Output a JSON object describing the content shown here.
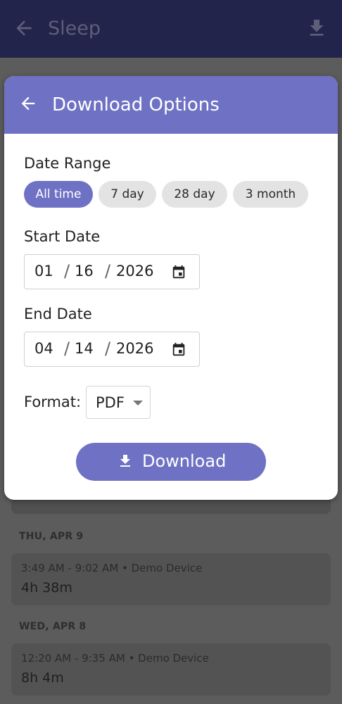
{
  "appbar": {
    "title": "Sleep",
    "back_icon": "arrow-left-icon",
    "download_icon": "download-icon"
  },
  "list": {
    "days": [
      {
        "label": "THU, APR 9",
        "meta": "3:49 AM - 9:02 AM • Demo Device",
        "duration": "4h 38m"
      },
      {
        "label": "WED, APR 8",
        "meta": "12:20 AM - 9:35 AM • Demo Device",
        "duration": "8h 4m"
      }
    ]
  },
  "dialog": {
    "title": "Download Options",
    "date_range_label": "Date Range",
    "chips": [
      "All time",
      "7 day",
      "28 day",
      "3 month"
    ],
    "selected_chip": "All time",
    "start_label": "Start Date",
    "start": {
      "month": "01",
      "day": "16",
      "year": "2026"
    },
    "end_label": "End Date",
    "end": {
      "month": "04",
      "day": "14",
      "year": "2026"
    },
    "format_label": "Format:",
    "format_value": "PDF",
    "download_label": "Download"
  },
  "colors": {
    "accent": "#6f72c4",
    "appbar": "#22244c",
    "chip": "#e3e3e3"
  }
}
